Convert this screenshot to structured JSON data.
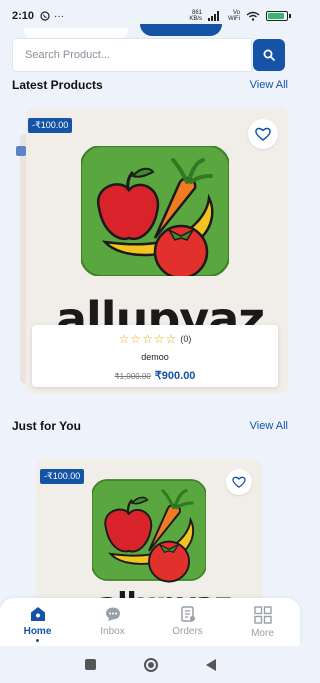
{
  "status_bar": {
    "time": "2:10",
    "net_speed_value": "861",
    "net_speed_unit": "KB/s",
    "network_label_top": "Vo",
    "network_label_bottom": "WiFi",
    "battery_level": 0.8
  },
  "search": {
    "placeholder": "Search Product..."
  },
  "latest_products": {
    "title": "Latest Products",
    "view_all_label": "View All",
    "items": [
      {
        "discount_label": "-₹100.00",
        "brand_text": "allupyaz",
        "rating_count": "(0)",
        "name": "demoo",
        "old_price": "₹1,000.00",
        "new_price": "₹900.00",
        "stars_filled": 0,
        "stars_total": 5
      }
    ]
  },
  "just_for_you": {
    "title": "Just for You",
    "view_all_label": "View All",
    "items": [
      {
        "discount_label": "-₹100.00",
        "brand_text": "allupyaz"
      }
    ]
  },
  "bottom_nav": {
    "items": [
      {
        "label": "Home",
        "icon": "home-icon",
        "active": true
      },
      {
        "label": "Inbox",
        "icon": "chat-icon",
        "active": false
      },
      {
        "label": "Orders",
        "icon": "orders-icon",
        "active": false
      },
      {
        "label": "More",
        "icon": "grid-icon",
        "active": false
      }
    ]
  },
  "colors": {
    "primary": "#1553a6",
    "background": "#eef3fb",
    "star": "#e3a21a",
    "card": "#f1ede9"
  }
}
